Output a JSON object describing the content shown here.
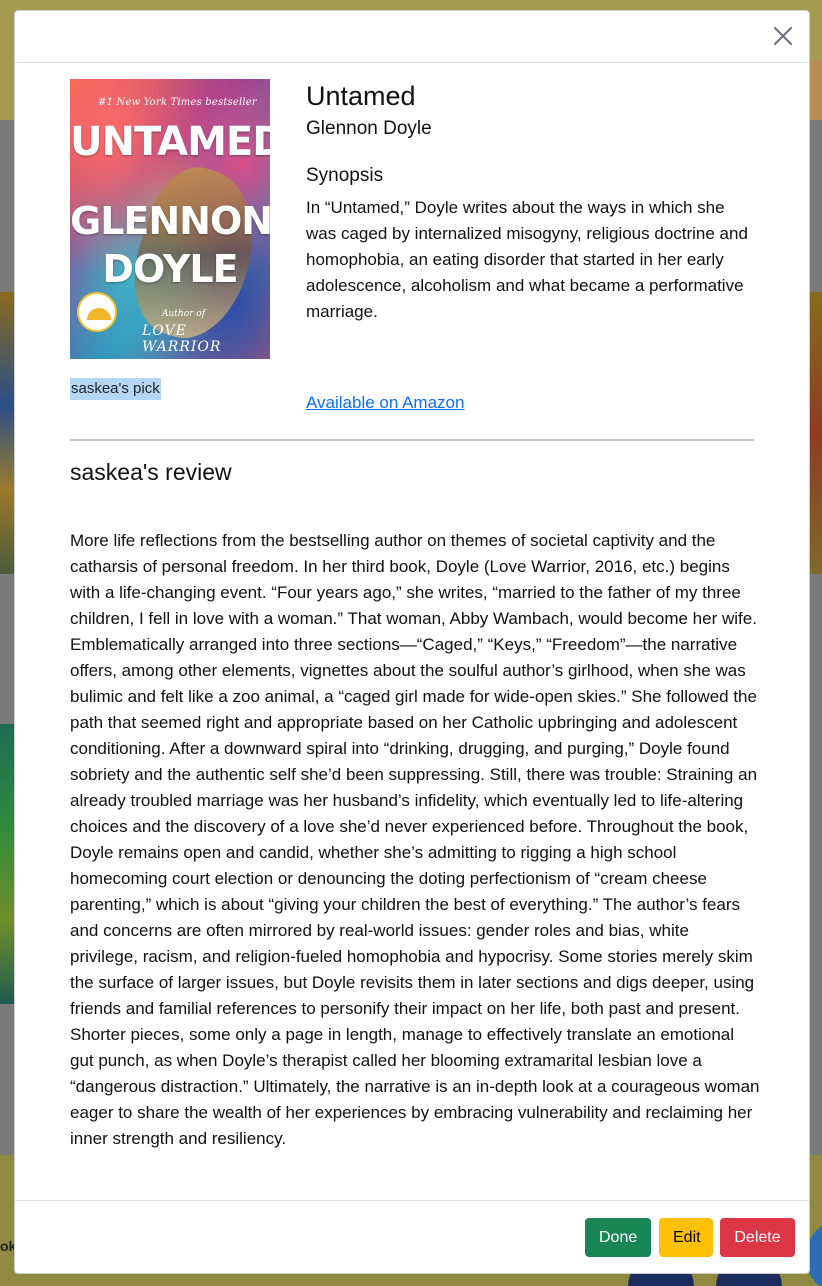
{
  "background": {
    "partial_text": "ok"
  },
  "modal": {
    "cover": {
      "top_line": "#1 New York Times bestseller",
      "title_line1": "UNTAMED",
      "title_line2": "GLENNON",
      "title_line3": "DOYLE",
      "author_of": "Author of",
      "subtitle": "LOVE WARRIOR"
    },
    "pick_label": "saskea's pick",
    "title": "Untamed",
    "author": "Glennon Doyle",
    "synopsis_heading": "Synopsis",
    "synopsis_text": "In “Untamed,” Doyle writes about the ways in which she was caged by internalized misogyny, religious doctrine and homophobia, an eating disorder that started in her early adolescence, alcoholism and what became a performative marriage.",
    "amazon_link": "Available on Amazon",
    "review_heading": "saskea's review",
    "review_text": "More life reflections from the bestselling author on themes of societal captivity and the catharsis of personal freedom. In her third book, Doyle (Love Warrior, 2016, etc.) begins with a life-changing event. “Four years ago,” she writes, “married to the father of my three children, I fell in love with a woman.” That woman, Abby Wambach, would become her wife. Emblematically arranged into three sections—“Caged,” “Keys,” “Freedom”—the narrative offers, among other elements, vignettes about the soulful author’s girlhood, when she was bulimic and felt like a zoo animal, a “caged girl made for wide-open skies.” She followed the path that seemed right and appropriate based on her Catholic upbringing and adolescent conditioning. After a downward spiral into “drinking, drugging, and purging,” Doyle found sobriety and the authentic self she’d been suppressing. Still, there was trouble: Straining an already troubled marriage was her husband’s infidelity, which eventually led to life-altering choices and the discovery of a love she’d never experienced before. Throughout the book, Doyle remains open and candid, whether she’s admitting to rigging a high school homecoming court election or denouncing the doting perfectionism of “cream cheese parenting,” which is about “giving your children the best of everything.” The author’s fears and concerns are often mirrored by real-world issues: gender roles and bias, white privilege, racism, and religion-fueled homophobia and hypocrisy. Some stories merely skim the surface of larger issues, but Doyle revisits them in later sections and digs deeper, using friends and familial references to personify their impact on her life, both past and present. Shorter pieces, some only a page in length, manage to effectively translate an emotional gut punch, as when Doyle’s therapist called her blooming extramarital lesbian love a “dangerous distraction.” Ultimately, the narrative is an in-depth look at a courageous woman eager to share the wealth of her experiences by embracing vulnerability and reclaiming her inner strength and resiliency.",
    "close_icon": "close-icon",
    "buttons": {
      "done": "Done",
      "edit": "Edit",
      "delete": "Delete"
    }
  },
  "colors": {
    "done": "#198754",
    "edit": "#ffc107",
    "delete": "#dc3545",
    "link": "#0d6efd",
    "highlight": "#b4d7f5"
  }
}
